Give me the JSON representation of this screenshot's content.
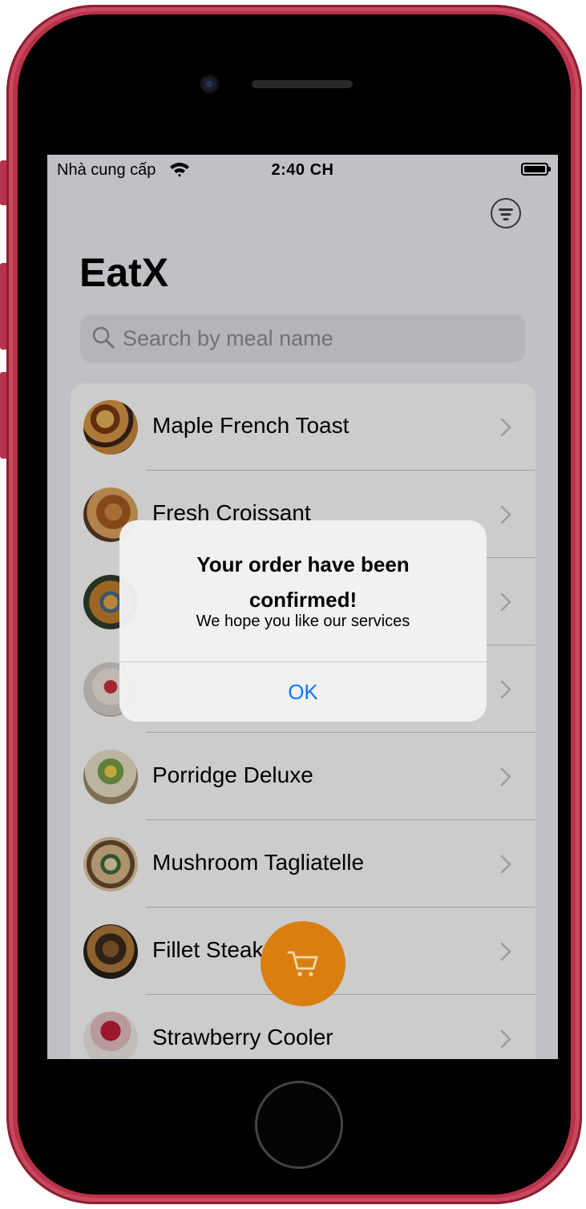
{
  "status_bar": {
    "carrier": "Nhà cung cấp",
    "time": "2:40 CH"
  },
  "app": {
    "title": "EatX",
    "search_placeholder": "Search by meal name"
  },
  "meals": [
    {
      "name": "Maple French Toast"
    },
    {
      "name": "Fresh Croissant"
    },
    {
      "name": ""
    },
    {
      "name": ""
    },
    {
      "name": "Porridge Deluxe"
    },
    {
      "name": "Mushroom Tagliatelle"
    },
    {
      "name": "Fillet Steak"
    },
    {
      "name": "Strawberry Cooler"
    }
  ],
  "alert": {
    "title": "Your order have been confirmed!",
    "message": "We hope you like our services",
    "ok_label": "OK"
  },
  "colors": {
    "accent": "#d87f10",
    "link_blue": "#0a7aff",
    "device_frame": "#b8334a"
  }
}
